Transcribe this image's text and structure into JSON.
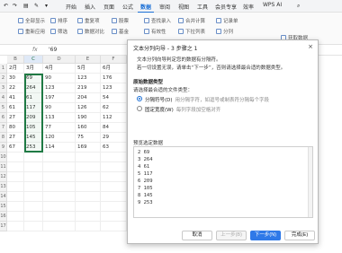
{
  "menu": {
    "items": [
      "开始",
      "插入",
      "页面",
      "公式",
      "数据",
      "审阅",
      "视图",
      "工具",
      "会员专享",
      "效率"
    ],
    "active_index": 4,
    "wps_ai": "WPS AI"
  },
  "ribbon": {
    "buttons": [
      "全部显示",
      "重新应用",
      "排序",
      "筛选",
      "重复项",
      "数据对比",
      "股票",
      "基金",
      "查找录入",
      "有效性",
      "下拉列表",
      "合并计算",
      "记录单",
      "分列",
      "获取数据"
    ]
  },
  "formula": {
    "fx": "fx",
    "value": "'69"
  },
  "sheet": {
    "columns": [
      "B",
      "C",
      "D",
      "E",
      "F"
    ],
    "header_row": [
      "2月",
      "3月",
      "4月",
      "5月",
      "6月"
    ],
    "rows": [
      [
        "30",
        "69",
        "90",
        "123",
        "176"
      ],
      [
        "22",
        "264",
        "123",
        "219",
        "123"
      ],
      [
        "41",
        "61",
        "197",
        "204",
        "54"
      ],
      [
        "61",
        "117",
        "90",
        "126",
        "62"
      ],
      [
        "27",
        "209",
        "113",
        "190",
        "112"
      ],
      [
        "80",
        "105",
        "77",
        "160",
        "84"
      ],
      [
        "27",
        "145",
        "120",
        "75",
        "29"
      ],
      [
        "67",
        "253",
        "114",
        "169",
        "63"
      ]
    ],
    "row_numbers": [
      "1",
      "2",
      "3",
      "4",
      "5",
      "6",
      "7",
      "8",
      "9",
      "10",
      "11",
      "12",
      "13",
      "14",
      "15",
      "16",
      "17"
    ]
  },
  "dialog": {
    "title": "文本分列向导 - 3 步骤之 1",
    "close": "×",
    "desc1": "文本分列向导判定您的数据有分隔符。",
    "desc2": "若一切设置无误，请单击“下一步”，否则请选择最合适的数据类型。",
    "section1": "原始数据类型",
    "section1_sub": "请选择最合适的文件类型：",
    "option1": "分隔符号(D)",
    "option1_hint": "用分隔字符，如逗号或制表符分隔每个字段",
    "option2": "固定宽度(W)",
    "option2_hint": "每列字段加空格对齐",
    "preview_label": "预览选定数据",
    "preview_rows": [
      "2  69",
      "3  264",
      "4  61",
      "5  117",
      "6  209",
      "7  105",
      "8  145",
      "9  253"
    ],
    "btn_cancel": "取消",
    "btn_prev": "上一步(B)",
    "btn_next": "下一步(N)",
    "btn_finish": "完成(E)"
  }
}
